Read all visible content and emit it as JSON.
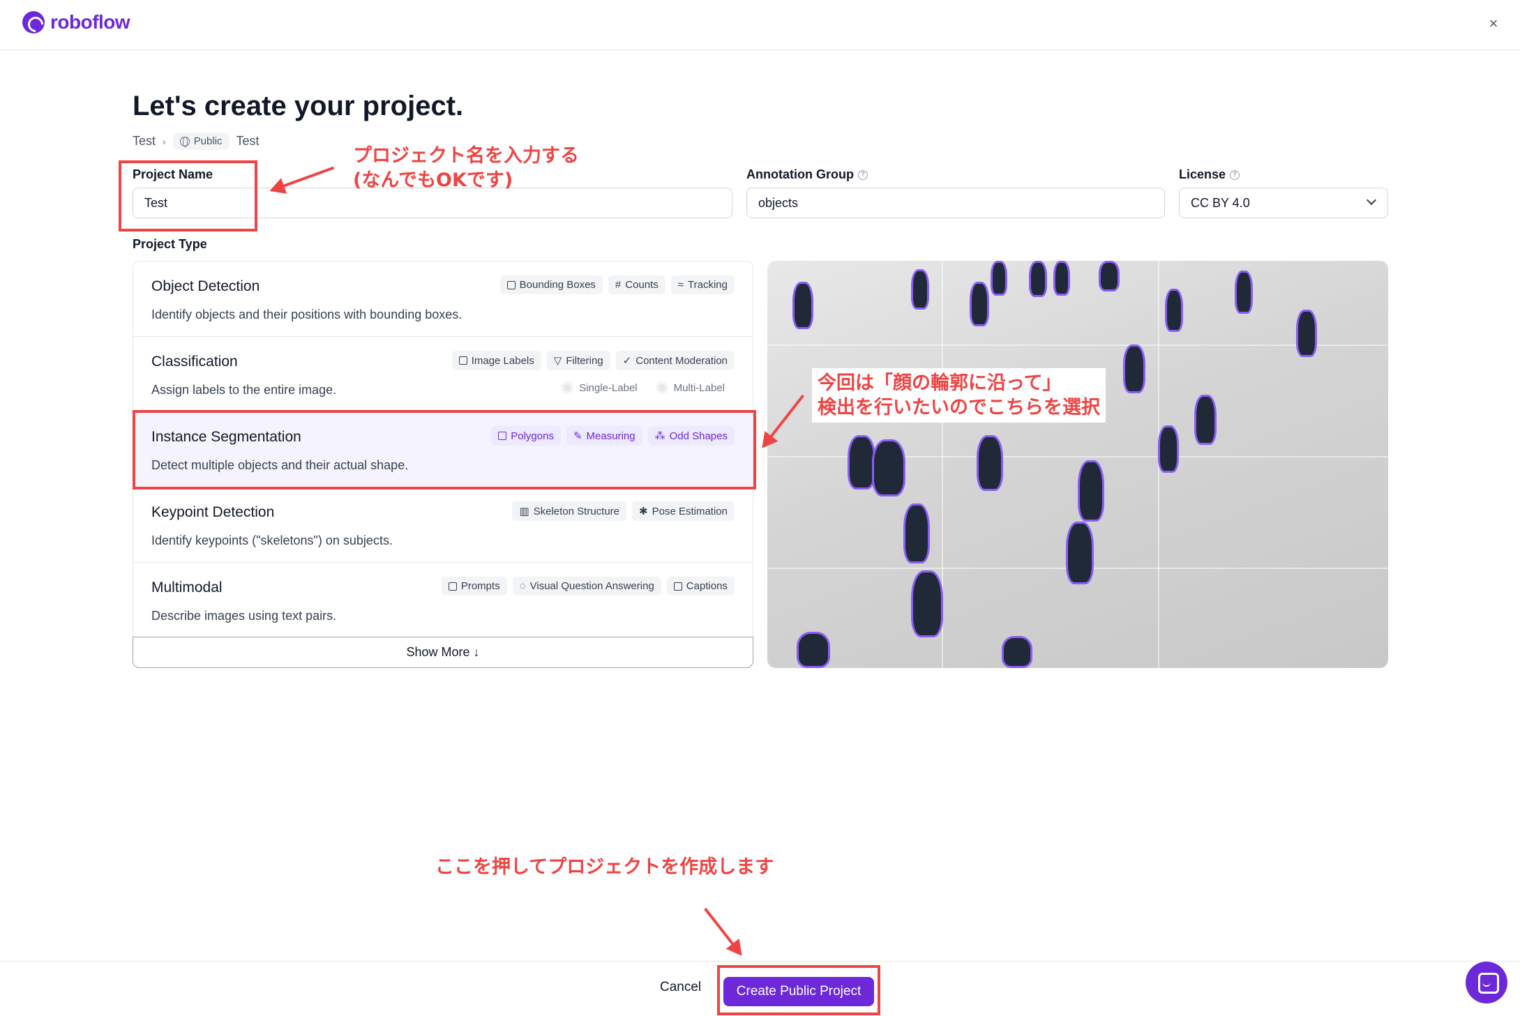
{
  "app": {
    "logo_text": "roboflow"
  },
  "header": {
    "close_label": "×"
  },
  "page": {
    "title": "Let's create your project.",
    "breadcrumb": {
      "workspace": "Test",
      "visibility": "Public",
      "project": "Test"
    }
  },
  "form": {
    "project_name": {
      "label": "Project Name",
      "value": "Test"
    },
    "annotation_group": {
      "label": "Annotation Group",
      "value": "objects"
    },
    "license": {
      "label": "License",
      "value": "CC BY 4.0"
    },
    "project_type_label": "Project Type"
  },
  "project_types": [
    {
      "name": "Object Detection",
      "desc": "Identify objects and their positions with bounding boxes.",
      "tags": [
        "Bounding Boxes",
        "Counts",
        "Tracking"
      ],
      "selected": false
    },
    {
      "name": "Classification",
      "desc": "Assign labels to the entire image.",
      "tags": [
        "Image Labels",
        "Filtering",
        "Content Moderation"
      ],
      "radios": [
        "Single-Label",
        "Multi-Label"
      ],
      "selected": false
    },
    {
      "name": "Instance Segmentation",
      "desc": "Detect multiple objects and their actual shape.",
      "tags": [
        "Polygons",
        "Measuring",
        "Odd Shapes"
      ],
      "selected": true
    },
    {
      "name": "Keypoint Detection",
      "desc": "Identify keypoints (\"skeletons\") on subjects.",
      "tags": [
        "Skeleton Structure",
        "Pose Estimation"
      ],
      "selected": false
    },
    {
      "name": "Multimodal",
      "desc": "Describe images using text pairs.",
      "tags": [
        "Prompts",
        "Visual Question Answering",
        "Captions"
      ],
      "selected": false
    }
  ],
  "show_more_label": "Show More ↓",
  "annotations": {
    "name_note_line1": "プロジェクト名を入力する",
    "name_note_line2": "(なんでもOKです)",
    "seg_note_line1": "今回は「顔の輪郭に沿って」",
    "seg_note_line2": "検出を行いたいのでこちらを選択",
    "create_note": "ここを押してプロジェクトを作成します"
  },
  "footer": {
    "cancel_label": "Cancel",
    "create_label": "Create Public Project"
  },
  "colors": {
    "accent": "#6d28d9",
    "annotation": "#ef4444",
    "selected_bg": "#f5f3ff"
  }
}
